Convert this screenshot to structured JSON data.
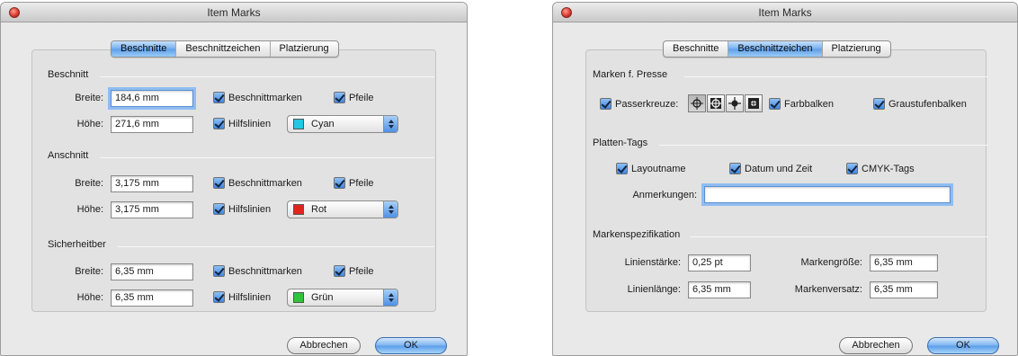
{
  "window_title": "Item Marks",
  "left": {
    "tabs": [
      "Beschnitte",
      "Beschnittzeichen",
      "Platzierung"
    ],
    "sections": [
      {
        "title": "Beschnitt",
        "width_label": "Breite:",
        "width_value": "184,6 mm",
        "height_label": "Höhe:",
        "height_value": "271,6 mm",
        "marks_label": "Beschnittmarken",
        "arrows_label": "Pfeile",
        "guides_label": "Hilfslinien",
        "color_name": "Cyan",
        "color_hex": "#22c7e6"
      },
      {
        "title": "Anschnitt",
        "width_label": "Breite:",
        "width_value": "3,175 mm",
        "height_label": "Höhe:",
        "height_value": "3,175 mm",
        "marks_label": "Beschnittmarken",
        "arrows_label": "Pfeile",
        "guides_label": "Hilfslinien",
        "color_name": "Rot",
        "color_hex": "#e0261c"
      },
      {
        "title": "Sicherheitber",
        "width_label": "Breite:",
        "width_value": "6,35 mm",
        "height_label": "Höhe:",
        "height_value": "6,35 mm",
        "marks_label": "Beschnittmarken",
        "arrows_label": "Pfeile",
        "guides_label": "Hilfslinien",
        "color_name": "Grün",
        "color_hex": "#2ec53a"
      }
    ],
    "cancel_label": "Abbrechen",
    "ok_label": "OK"
  },
  "right": {
    "tabs": [
      "Beschnitte",
      "Beschnittzeichen",
      "Platzierung"
    ],
    "press_marks": {
      "title": "Marken f. Presse",
      "registration_label": "Passerkreuze:",
      "registration_icons": [
        "registration-target-icon",
        "registration-target-icon",
        "registration-target-icon",
        "registration-target-icon"
      ],
      "color_bars_label": "Farbbalken",
      "gray_bars_label": "Graustufenbalken"
    },
    "plate_tags": {
      "title": "Platten-Tags",
      "layout_name_label": "Layoutname",
      "date_time_label": "Datum und Zeit",
      "cmyk_label": "CMYK-Tags",
      "notes_label": "Anmerkungen:",
      "notes_value": ""
    },
    "mark_spec": {
      "title": "Markenspezifikation",
      "line_weight_label": "Linienstärke:",
      "line_weight_value": "0,25 pt",
      "mark_size_label": "Markengröße:",
      "mark_size_value": "6,35 mm",
      "line_length_label": "Linienlänge:",
      "line_length_value": "6,35 mm",
      "mark_offset_label": "Markenversatz:",
      "mark_offset_value": "6,35 mm"
    },
    "cancel_label": "Abbrechen",
    "ok_label": "OK"
  },
  "colors": {
    "tab_active": "#73aef0",
    "checkbox_fill": "#3d86e1",
    "window_bg": "#e9e9e9"
  }
}
